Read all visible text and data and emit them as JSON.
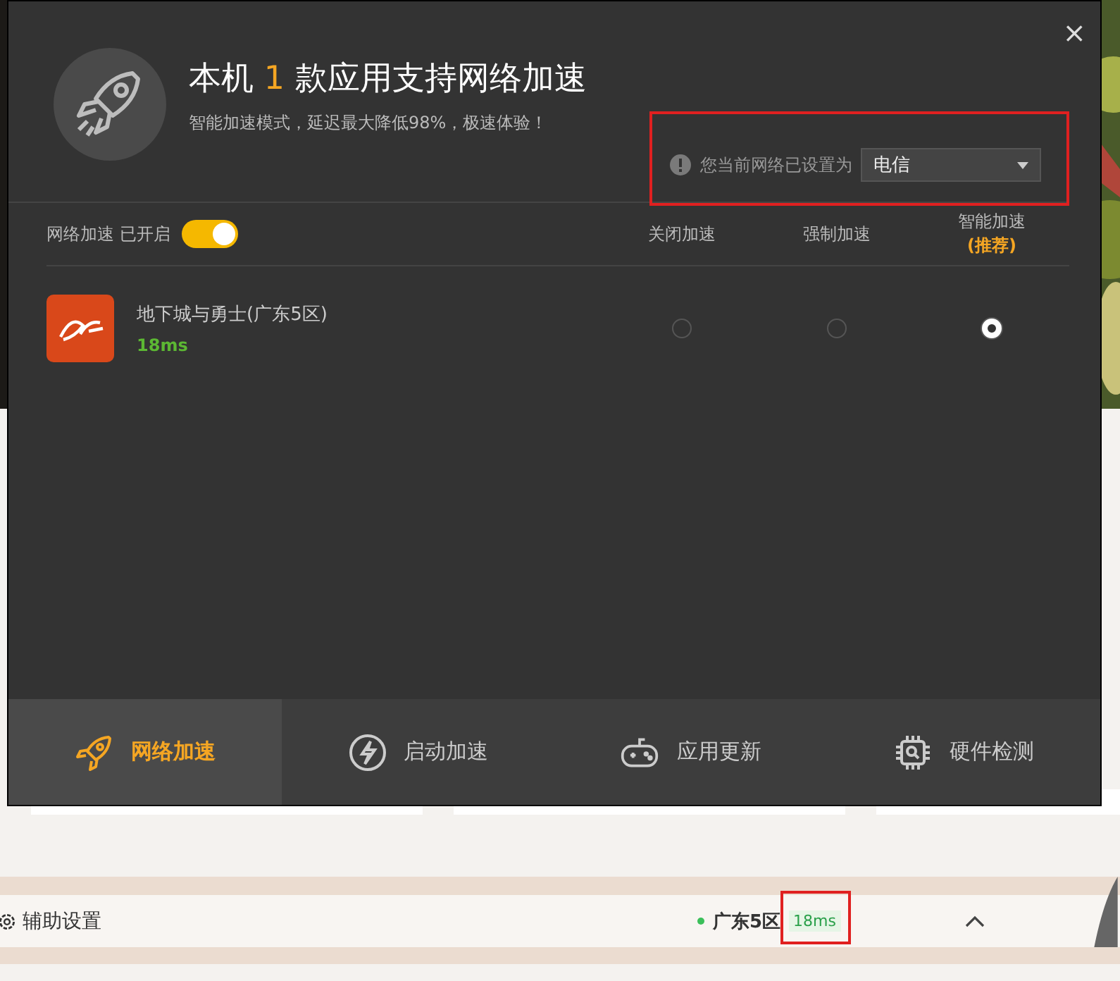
{
  "dialog": {
    "close": "×",
    "title_prefix": "本机",
    "count": "1",
    "title_suffix": "款应用支持网络加速",
    "subtitle": "智能加速模式，延迟最大降低98%，极速体验！",
    "network": {
      "label": "您当前网络已设置为",
      "value": "电信"
    },
    "acceleration": {
      "label": "网络加速 已开启",
      "on": true
    },
    "columns": [
      {
        "label": "关闭加速"
      },
      {
        "label": "强制加速"
      },
      {
        "label": "智能加速",
        "note": "(推荐)"
      }
    ],
    "apps": [
      {
        "name": "地下城与勇士(广东5区)",
        "latency": "18ms",
        "modes": [
          {
            "selected": false
          },
          {
            "selected": false
          },
          {
            "selected": true
          }
        ]
      }
    ],
    "tabs": [
      {
        "label": "网络加速",
        "kind": "rocket",
        "selected": true
      },
      {
        "label": "启动加速",
        "kind": "bolt",
        "selected": false
      },
      {
        "label": "应用更新",
        "kind": "gamepad",
        "selected": false
      },
      {
        "label": "硬件检测",
        "kind": "chip",
        "selected": false
      }
    ]
  },
  "bottom_bar": {
    "settings": "辅助设置",
    "server": "广东5区",
    "latency": "18ms",
    "online": true
  }
}
